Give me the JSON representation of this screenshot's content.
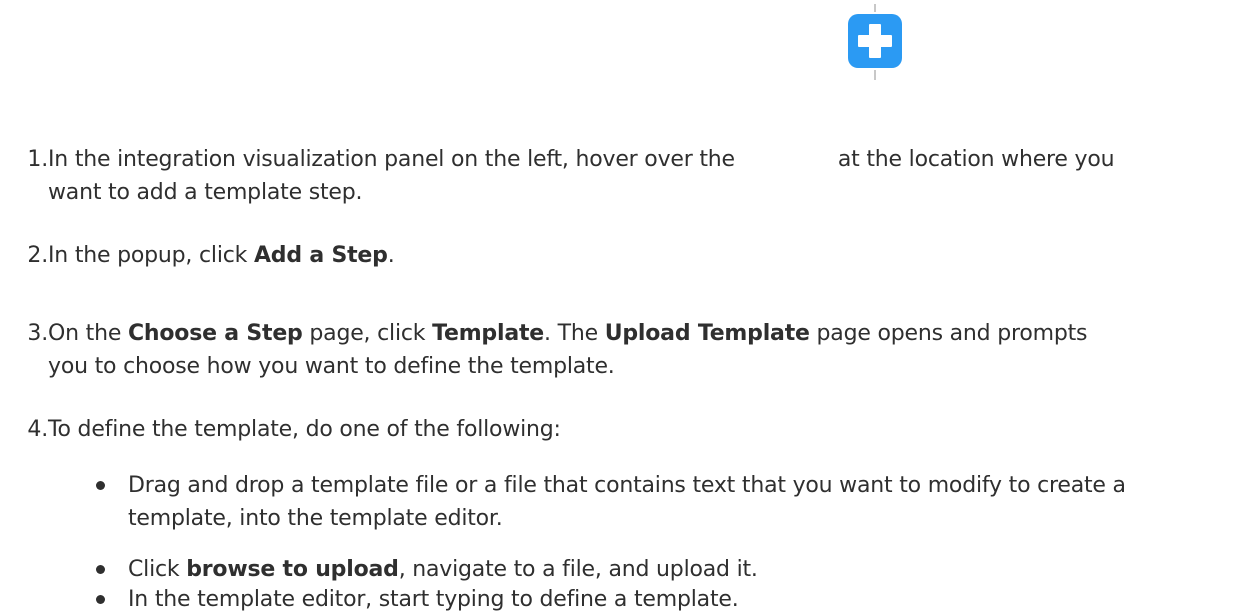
{
  "steps": [
    {
      "number": "1.",
      "pre": "In the integration visualization panel on the left, hover over the",
      "post": "at the location where you",
      "line2": "want to add a template step."
    },
    {
      "number": "2.",
      "pre": "In the popup, click ",
      "bold": "Add a Step",
      "post": "."
    },
    {
      "number": "3.",
      "pre": "On the ",
      "bold1": "Choose a Step",
      "mid1": " page, click ",
      "bold2": "Template",
      "mid2": ". The ",
      "bold3": "Upload Template",
      "post": " page opens and prompts",
      "line2": "you to choose how you want to define the template."
    },
    {
      "number": "4.",
      "text": "To define the template, do one of the following:"
    }
  ],
  "bullets": [
    {
      "line1": "Drag and drop a template file or a file that contains text that you want to modify to create a",
      "line2": "template, into the template editor."
    },
    {
      "pre": "Click ",
      "bold": "browse to upload",
      "post": ", navigate to a file, and upload it."
    },
    {
      "text": "In the template editor, start typing to define a template."
    }
  ],
  "icons": {
    "plus": "plus-icon",
    "plus_color": "#2b9af3"
  }
}
